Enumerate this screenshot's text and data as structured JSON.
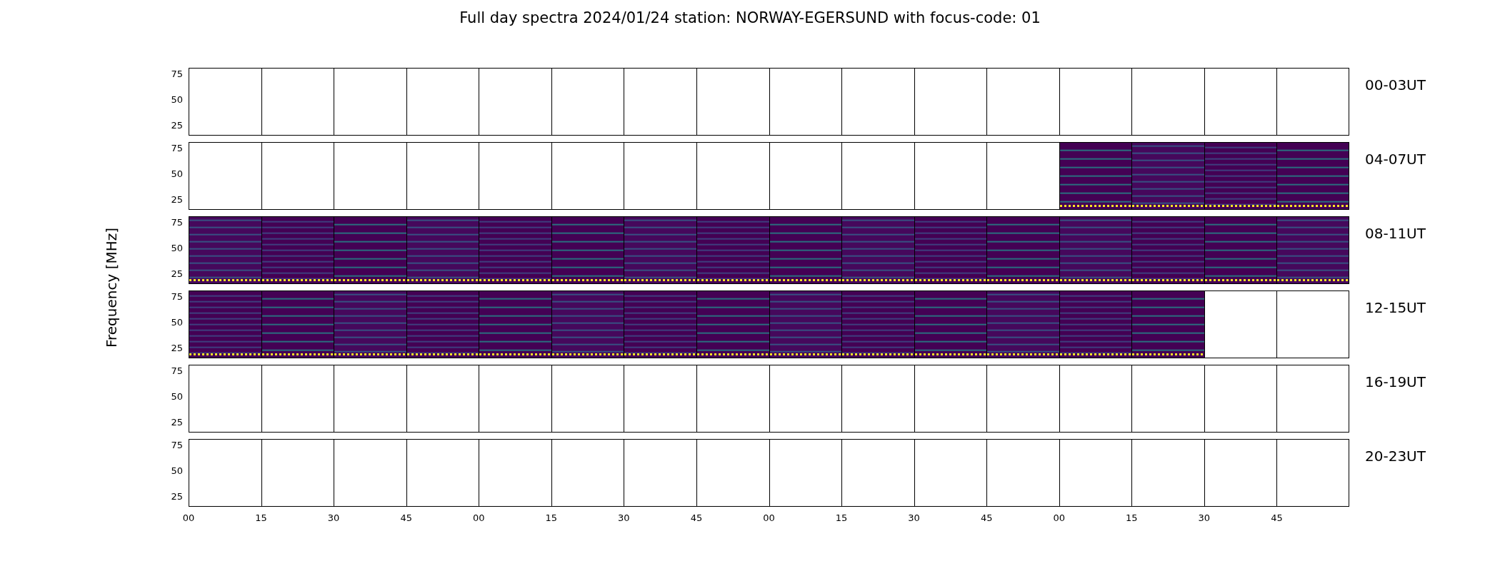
{
  "title": "Full day spectra 2024/01/24 station: NORWAY-EGERSUND with focus-code: 01",
  "ylabel": "Frequency [MHz]",
  "x_ticks": [
    "00",
    "15",
    "30",
    "45",
    "00",
    "15",
    "30",
    "45",
    "00",
    "15",
    "30",
    "45",
    "00",
    "15",
    "30",
    "45"
  ],
  "rows": [
    {
      "label": "00-03UT",
      "y_ticks": [
        "75",
        "50",
        "25"
      ],
      "panels": [
        {
          "has_data": false
        },
        {
          "has_data": false
        },
        {
          "has_data": false
        },
        {
          "has_data": false
        },
        {
          "has_data": false
        },
        {
          "has_data": false
        },
        {
          "has_data": false
        },
        {
          "has_data": false
        },
        {
          "has_data": false
        },
        {
          "has_data": false
        },
        {
          "has_data": false
        },
        {
          "has_data": false
        },
        {
          "has_data": false
        },
        {
          "has_data": false
        },
        {
          "has_data": false
        },
        {
          "has_data": false
        }
      ]
    },
    {
      "label": "04-07UT",
      "y_ticks": [
        "75",
        "50",
        "25"
      ],
      "panels": [
        {
          "has_data": false
        },
        {
          "has_data": false
        },
        {
          "has_data": false
        },
        {
          "has_data": false
        },
        {
          "has_data": false
        },
        {
          "has_data": false
        },
        {
          "has_data": false
        },
        {
          "has_data": false
        },
        {
          "has_data": false
        },
        {
          "has_data": false
        },
        {
          "has_data": false
        },
        {
          "has_data": false
        },
        {
          "has_data": true
        },
        {
          "has_data": true
        },
        {
          "has_data": true
        },
        {
          "has_data": true
        }
      ]
    },
    {
      "label": "08-11UT",
      "y_ticks": [
        "75",
        "50",
        "25"
      ],
      "panels": [
        {
          "has_data": true
        },
        {
          "has_data": true
        },
        {
          "has_data": true
        },
        {
          "has_data": true
        },
        {
          "has_data": true
        },
        {
          "has_data": true
        },
        {
          "has_data": true
        },
        {
          "has_data": true
        },
        {
          "has_data": true
        },
        {
          "has_data": true
        },
        {
          "has_data": true
        },
        {
          "has_data": true
        },
        {
          "has_data": true
        },
        {
          "has_data": true
        },
        {
          "has_data": true
        },
        {
          "has_data": true
        }
      ]
    },
    {
      "label": "12-15UT",
      "y_ticks": [
        "75",
        "50",
        "25"
      ],
      "panels": [
        {
          "has_data": true
        },
        {
          "has_data": true
        },
        {
          "has_data": true
        },
        {
          "has_data": true
        },
        {
          "has_data": true
        },
        {
          "has_data": true
        },
        {
          "has_data": true
        },
        {
          "has_data": true
        },
        {
          "has_data": true
        },
        {
          "has_data": true
        },
        {
          "has_data": true
        },
        {
          "has_data": true
        },
        {
          "has_data": true
        },
        {
          "has_data": true
        },
        {
          "has_data": false
        },
        {
          "has_data": false
        }
      ]
    },
    {
      "label": "16-19UT",
      "y_ticks": [
        "75",
        "50",
        "25"
      ],
      "panels": [
        {
          "has_data": false
        },
        {
          "has_data": false
        },
        {
          "has_data": false
        },
        {
          "has_data": false
        },
        {
          "has_data": false
        },
        {
          "has_data": false
        },
        {
          "has_data": false
        },
        {
          "has_data": false
        },
        {
          "has_data": false
        },
        {
          "has_data": false
        },
        {
          "has_data": false
        },
        {
          "has_data": false
        },
        {
          "has_data": false
        },
        {
          "has_data": false
        },
        {
          "has_data": false
        },
        {
          "has_data": false
        }
      ]
    },
    {
      "label": "20-23UT",
      "y_ticks": [
        "75",
        "50",
        "25"
      ],
      "panels": [
        {
          "has_data": false
        },
        {
          "has_data": false
        },
        {
          "has_data": false
        },
        {
          "has_data": false
        },
        {
          "has_data": false
        },
        {
          "has_data": false
        },
        {
          "has_data": false
        },
        {
          "has_data": false
        },
        {
          "has_data": false
        },
        {
          "has_data": false
        },
        {
          "has_data": false
        },
        {
          "has_data": false
        },
        {
          "has_data": false
        },
        {
          "has_data": false
        },
        {
          "has_data": false
        },
        {
          "has_data": false
        }
      ]
    }
  ]
}
